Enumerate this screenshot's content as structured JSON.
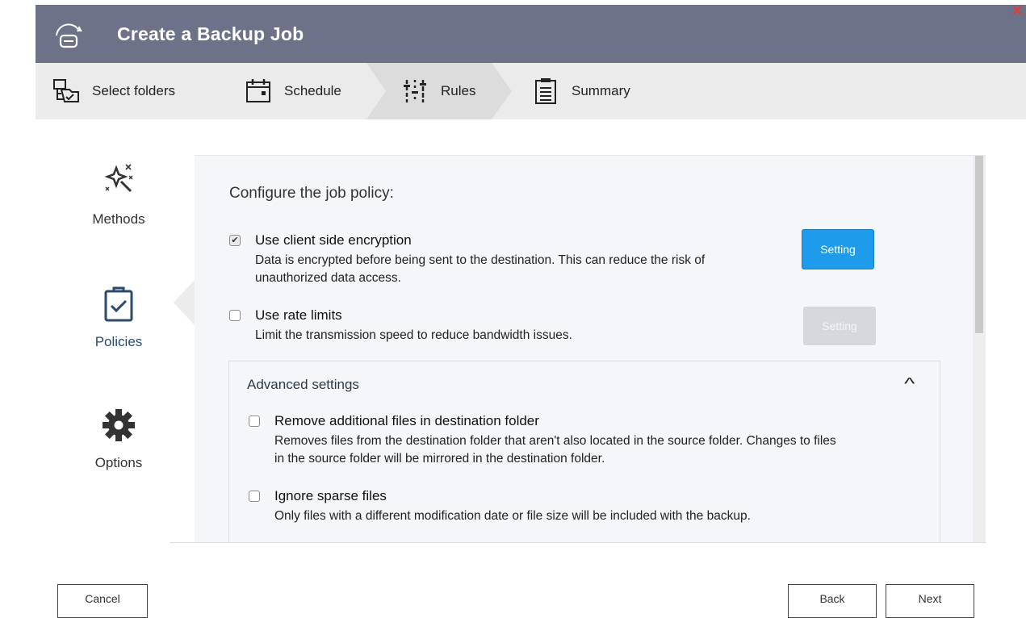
{
  "window": {
    "title": "Create a Backup Job",
    "close_glyph": "×",
    "app_icon": "backup-drive-icon"
  },
  "steps": [
    {
      "label": "Select folders",
      "icon": "folder-tree-icon"
    },
    {
      "label": "Schedule",
      "icon": "calendar-icon"
    },
    {
      "label": "Rules",
      "icon": "sliders-icon"
    },
    {
      "label": "Summary",
      "icon": "clipboard-list-icon"
    }
  ],
  "active_step": "Rules",
  "sidenav": [
    {
      "label": "Methods",
      "icon": "magic-wand-icon"
    },
    {
      "label": "Policies",
      "icon": "clipboard-check-icon"
    },
    {
      "label": "Options",
      "icon": "gear-icon"
    }
  ],
  "active_nav": "Policies",
  "panel": {
    "heading": "Configure the job policy:",
    "options": [
      {
        "title": "Use client side encryption",
        "description": "Data is encrypted before being sent to the destination. This can reduce the risk of unauthorized data access.",
        "checked": true,
        "setting_label": "Setting",
        "setting_enabled": true
      },
      {
        "title": "Use rate limits",
        "description": "Limit the transmission speed to reduce bandwidth issues.",
        "checked": false,
        "setting_label": "Setting",
        "setting_enabled": false
      }
    ],
    "advanced": {
      "title": "Advanced settings",
      "expanded": true,
      "options": [
        {
          "title": "Remove additional files in destination folder",
          "description": "Removes files from the destination folder that aren't also located in the source folder. Changes to files in the source folder will be mirrored in the destination folder.",
          "checked": false
        },
        {
          "title": "Ignore sparse files",
          "description": "Only files with a different modification date or file size will be included with the backup.",
          "checked": false
        }
      ]
    }
  },
  "footer": {
    "cancel_label": "Cancel",
    "back_label": "Back",
    "next_label": "Next"
  },
  "colors": {
    "titlebar": "#6d7289",
    "accent": "#1e9bea",
    "close": "#e53935",
    "active_nav_text": "#2c4a6e"
  }
}
